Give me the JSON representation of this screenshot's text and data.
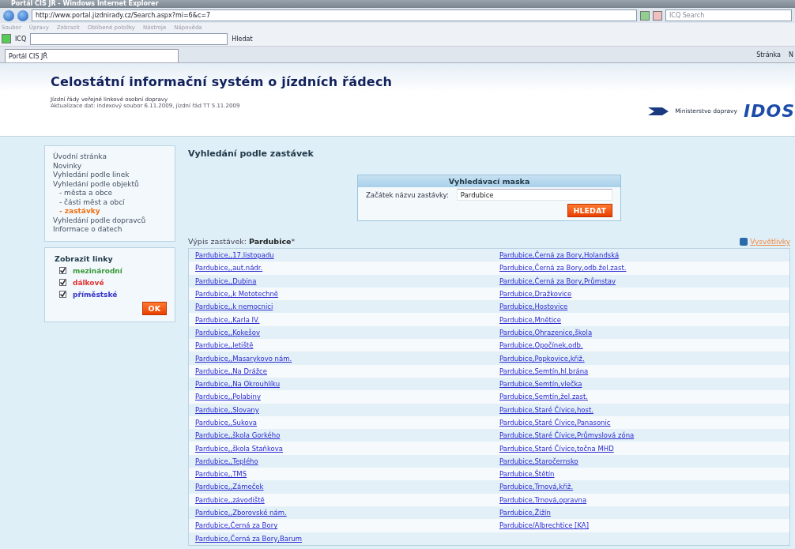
{
  "window": {
    "title": "Portál CIS JŘ - Windows Internet Explorer"
  },
  "address_bar": {
    "url": "http://www.portal.jizdnirady.cz/Search.aspx?mi=6&c=7",
    "search_placeholder": "ICQ Search"
  },
  "menu": [
    "Soubor",
    "Úpravy",
    "Zobrazit",
    "Oblíbené položky",
    "Nástroje",
    "Nápověda"
  ],
  "toolbar": {
    "label": "ICQ",
    "search_button": "Hledat"
  },
  "tabs": [
    {
      "label": "Portál CIS JŘ",
      "selected": true
    }
  ],
  "command_bar": [
    "Stránka",
    "N"
  ],
  "header": {
    "title": "Celostátní informační systém o jízdních řádech",
    "subtitle": "Jízdní řády veřejné linkové osobní dopravy",
    "update": "Aktualizace dat: indexový soubor 6.11.2009, jízdní řád TT 5.11.2009",
    "ministry": "Ministerstvo dopravy",
    "logo": "IDOS"
  },
  "sidebar": {
    "items": [
      {
        "label": "Úvodní stránka",
        "selected": false
      },
      {
        "label": "Novinky",
        "selected": false
      },
      {
        "label": "Vyhledání podle linek",
        "selected": false
      },
      {
        "label": "Vyhledání podle objektů",
        "selected": false,
        "children": [
          {
            "label": "- města a obce",
            "selected": false
          },
          {
            "label": "- části měst a obcí",
            "selected": false
          },
          {
            "label": "- zastávky",
            "selected": true
          }
        ]
      },
      {
        "label": "Vyhledání podle dopravců",
        "selected": false
      },
      {
        "label": "Informace o datech",
        "selected": false
      }
    ]
  },
  "filter": {
    "title": "Zobrazit linky",
    "options": [
      {
        "label": "mezinárodní",
        "checked": true,
        "color": "#3a9a3a"
      },
      {
        "label": "dálkové",
        "checked": true,
        "color": "#e03030"
      },
      {
        "label": "příměstské",
        "checked": true,
        "color": "#3434c8"
      }
    ],
    "button": "OK"
  },
  "page_title": "Vyhledání podle zastávek",
  "search_mask": {
    "title": "Vyhledávací maska",
    "label": "Začátek názvu zastávky:",
    "value": "Pardubice",
    "button": "HLEDAT"
  },
  "results": {
    "caption": "Výpis zastávek: **Pardubice***",
    "help_link": "Vysvětlivky",
    "column_1": [
      "Pardubice,,17.listopadu",
      "Pardubice,,aut.nádr.",
      "Pardubice,,Dubina",
      "Pardubice,,k Mototechně",
      "Pardubice,,k nemocnici",
      "Pardubice,,Karla IV.",
      "Pardubice,,Kokešov",
      "Pardubice,,letiště",
      "Pardubice,,Masarykovo nám.",
      "Pardubice,,Na Drážce",
      "Pardubice,,Na Okrouhlíku",
      "Pardubice,,Polabiny",
      "Pardubice,,Slovany",
      "Pardubice,,Sukova",
      "Pardubice,,škola Gorkého",
      "Pardubice,,škola Staňkova",
      "Pardubice,,Teplého",
      "Pardubice,,TMS",
      "Pardubice,,Zámeček",
      "Pardubice,,závodiště",
      "Pardubice,,Zborovské nám.",
      "Pardubice,Černá za Bory",
      "Pardubice,Černá za Bory,Barum"
    ],
    "column_2": [
      "Pardubice,Černá za Bory,Holandská",
      "Pardubice,Černá za Bory,odb.žel.zast.",
      "Pardubice,Černá za Bory,Průmstav",
      "Pardubice,Dražkovice",
      "Pardubice,Hostovice",
      "Pardubice,Mnětice",
      "Pardubice,Ohrazenice,škola",
      "Pardubice,Opočínek,odb.",
      "Pardubice,Popkovice,křiž.",
      "Pardubice,Semtín,hl.brána",
      "Pardubice,Semtín,vlečka",
      "Pardubice,Semtín,žel.zast.",
      "Pardubice,Staré Čívice,host.",
      "Pardubice,Staré Čívice,Panasonic",
      "Pardubice,Staré Čívice,Průmyslová zóna",
      "Pardubice,Staré Čívice,točna MHD",
      "Pardubice,Staročernsko",
      "Pardubice,Štětín",
      "Pardubice,Trnová,křiž.",
      "Pardubice,Trnová,opravna",
      "Pardubice,Žižín",
      "Pardubice/Albrechtice [KA]"
    ]
  }
}
